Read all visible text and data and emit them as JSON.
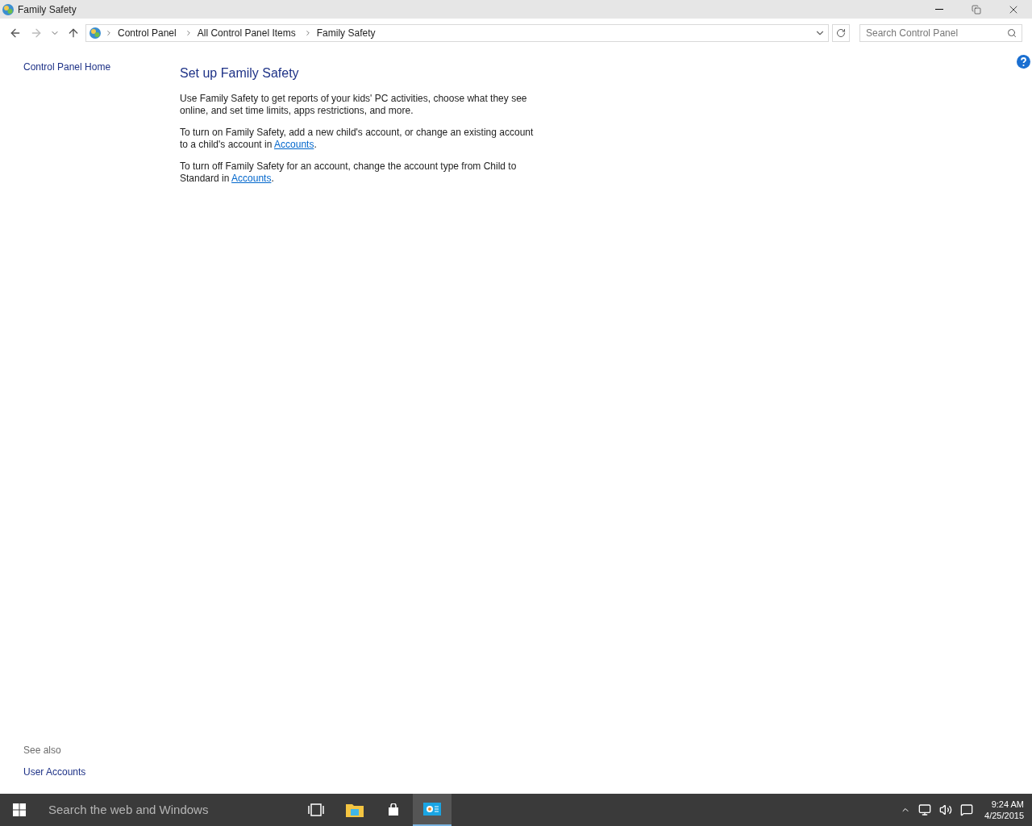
{
  "window": {
    "title": "Family Safety"
  },
  "address_bar": {
    "breadcrumbs": [
      "Control Panel",
      "All Control Panel Items",
      "Family Safety"
    ]
  },
  "search": {
    "placeholder": "Search Control Panel"
  },
  "sidebar": {
    "home_link": "Control Panel Home",
    "see_also_title": "See also",
    "see_also_links": [
      "User Accounts"
    ]
  },
  "content": {
    "heading": "Set up Family Safety",
    "paragraphs": [
      {
        "text": "Use Family Safety to get reports of your kids' PC activities, choose what they see online, and set time limits, apps restrictions, and more."
      },
      {
        "text": "To turn on Family Safety, add a new child's account, or change an existing account to a child's account in ",
        "link": "Accounts",
        "after": "."
      },
      {
        "text": "To turn off Family Safety for an account, change the account type from Child to Standard in ",
        "link": "Accounts",
        "after": "."
      }
    ]
  },
  "taskbar": {
    "search_placeholder": "Search the web and Windows",
    "apps": [
      {
        "kind": "taskview",
        "selected": false
      },
      {
        "kind": "explorer",
        "selected": false
      },
      {
        "kind": "store",
        "selected": false
      },
      {
        "kind": "controlpanel",
        "selected": true
      }
    ],
    "time": "9:24 AM",
    "date": "4/25/2015"
  }
}
